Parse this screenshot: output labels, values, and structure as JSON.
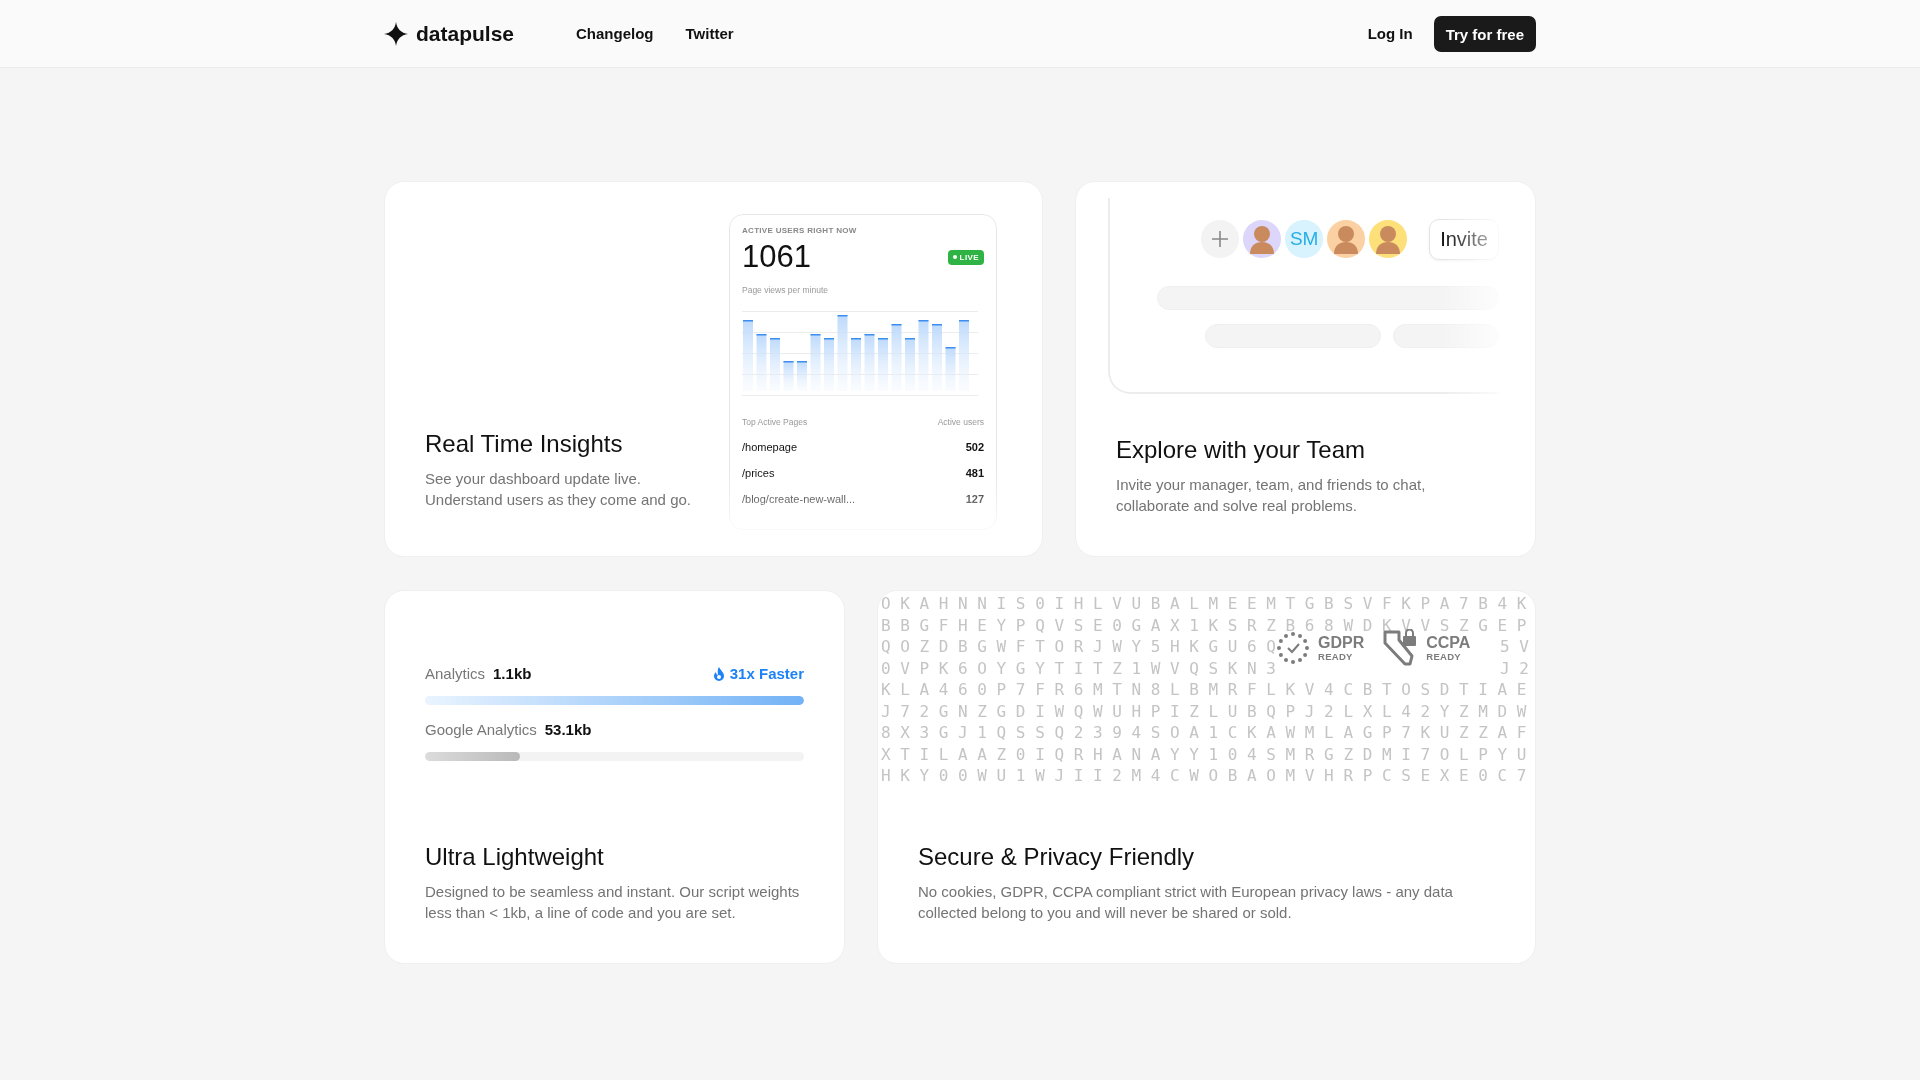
{
  "header": {
    "logo": "datapulse",
    "links": [
      "Changelog",
      "Twitter"
    ],
    "login": "Log In",
    "cta": "Try for free"
  },
  "cards": [
    {
      "kind": "realtime",
      "title": "Real Time Insights",
      "description": "See your dashboard update live. Understand users as they come and go.",
      "widget": {
        "caption": "ACTIVE USERS RIGHT NOW",
        "count": "1061",
        "badge": "LIVE",
        "chart_caption": "Page views per minute",
        "table_headers": [
          "Top Active Pages",
          "Active users"
        ],
        "rows": [
          {
            "page": "/homepage",
            "users": "502"
          },
          {
            "page": "/prices",
            "users": "481"
          },
          {
            "page": "/blog/create-new-wall...",
            "users": "127"
          }
        ]
      }
    },
    {
      "kind": "team",
      "title": "Explore with your Team",
      "description": "Invite your manager, team, and friends to chat, collaborate and solve real problems.",
      "avatars": [
        {
          "kind": "add"
        },
        {
          "kind": "picture",
          "color": "#ddd6fb"
        },
        {
          "kind": "initials",
          "initials": "SM",
          "color": "#d8f3fd"
        },
        {
          "kind": "picture",
          "color": "#fbd0a2"
        },
        {
          "kind": "picture",
          "color": "#fde07a"
        }
      ],
      "invite": "Invite"
    },
    {
      "kind": "size",
      "title": "Ultra Lightweight",
      "description": "Designed to be seamless and instant. Our script weights less than < 1kb, a line of code and you are set.",
      "bars": [
        {
          "name": "Analytics",
          "size": "1.1kb",
          "note": "31x Faster",
          "level": 1,
          "highlight": true
        },
        {
          "name": "Google Analytics",
          "size": "53.1kb",
          "level": 0.25,
          "highlight": false
        }
      ]
    },
    {
      "kind": "privacy",
      "title": "Secure & Privacy Friendly",
      "description": "No cookies, GDPR, CCPA compliant strict with European privacy laws - any data collected belong to you and will never be shared or sold.",
      "badges": [
        {
          "kind": "gdpr",
          "name": "GDPR",
          "sub": "READY"
        },
        {
          "kind": "ccpa",
          "name": "CCPA",
          "sub": "READY"
        }
      ],
      "grid": [
        [
          "O K A H N N I S 0 I H L V U B A L M E E M T G B S V F K P A 7 B 4 K"
        ],
        [
          "B B G F H E Y P Q V S E 0 G A X 1 K S R Z B 6 8 W D K V V S Z G E P"
        ],
        [
          "Q O Z D B G W F T O R J W Y 5 H K G U 6 Q",
          "5 V"
        ],
        [
          "0 V P K 6 O Y G Y T I T Z 1 W V Q S K N 3",
          "J 2"
        ],
        [
          "K L A 4 6 0 P 7 F R 6 M T N 8 L B M R F L K V 4 C B T O S D T I A E"
        ],
        [
          "J 7 2 G N Z G D I W Q W U H P I Z L U B Q P J 2 L X L 4 2 Y Z M D W"
        ],
        [
          "8 X 3 G J 1 Q S S Q 2 3 9 4 S O A 1 C K A W M L A G P 7 K U Z Z A F"
        ],
        [
          "X T I L A A Z 0 I Q R H A N A Y Y 1 0 4 S M R G Z D M I 7 O L P Y U"
        ],
        [
          "H K Y 0 0 W U 1 W J I I 2 M 4 C W O B A O M V H R P C S E X E 0 C 7"
        ]
      ]
    }
  ]
}
